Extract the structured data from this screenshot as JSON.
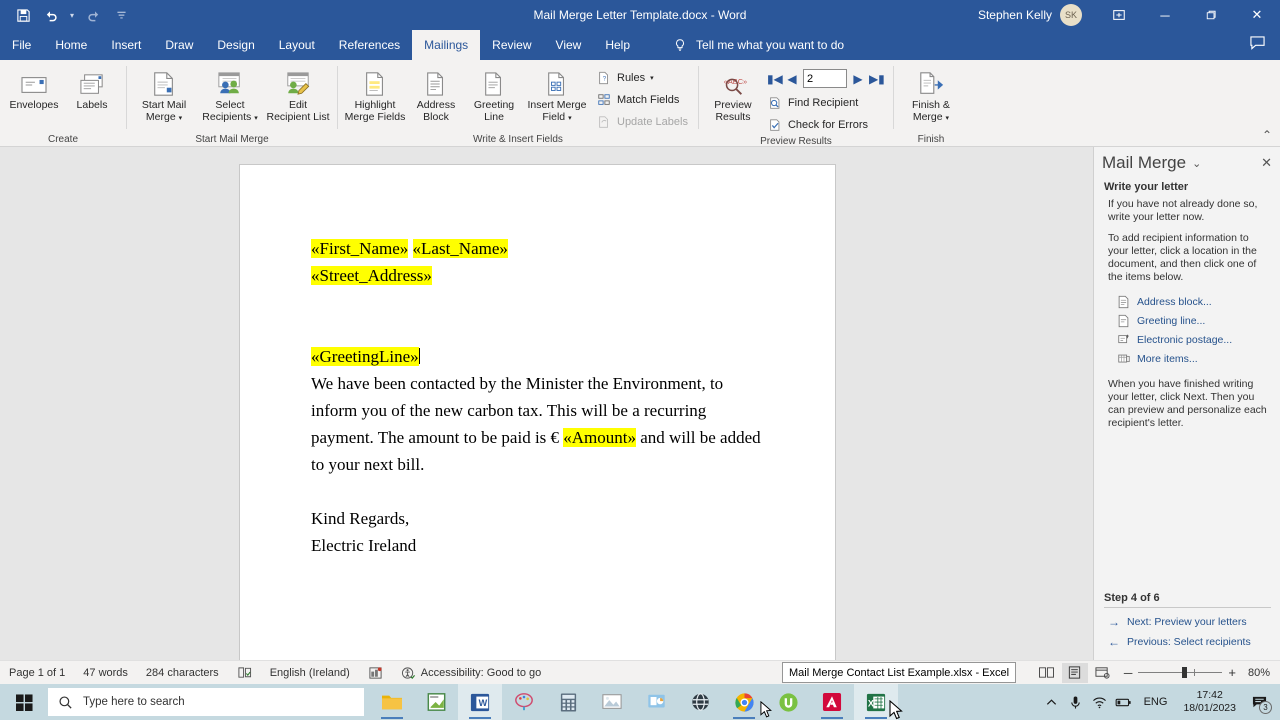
{
  "titlebar": {
    "document_title": "Mail Merge Letter Template.docx  -  Word",
    "user_name": "Stephen Kelly",
    "avatar_initials": "SK",
    "qat": [
      {
        "name": "save-icon",
        "label": "Save"
      },
      {
        "name": "undo-icon",
        "label": "Undo"
      },
      {
        "name": "redo-icon",
        "label": "Repeat"
      },
      {
        "name": "customize-qat-icon",
        "label": "Customize Quick Access Toolbar"
      }
    ],
    "window_buttons": {
      "ribbon_display": "Ribbon Display Options",
      "minimize": "─",
      "restore": "❐",
      "close": "✕"
    },
    "comments_icon": "comment-icon"
  },
  "tabs": [
    {
      "label": "File",
      "active": false
    },
    {
      "label": "Home",
      "active": false
    },
    {
      "label": "Insert",
      "active": false
    },
    {
      "label": "Draw",
      "active": false
    },
    {
      "label": "Design",
      "active": false
    },
    {
      "label": "Layout",
      "active": false
    },
    {
      "label": "References",
      "active": false
    },
    {
      "label": "Mailings",
      "active": true
    },
    {
      "label": "Review",
      "active": false
    },
    {
      "label": "View",
      "active": false
    },
    {
      "label": "Help",
      "active": false
    }
  ],
  "tellme": {
    "placeholder": "Tell me what you want to do"
  },
  "ribbon": {
    "groups": [
      {
        "name": "Create",
        "label": "Create",
        "buttons": [
          {
            "label1": "Envelopes",
            "label2": "",
            "icon": "envelope-icon",
            "dropdown": false
          },
          {
            "label1": "Labels",
            "label2": "",
            "icon": "labels-icon",
            "dropdown": false
          }
        ]
      },
      {
        "name": "Start Mail Merge",
        "label": "Start Mail Merge",
        "buttons": [
          {
            "label1": "Start Mail",
            "label2": "Merge",
            "icon": "start-mail-merge-icon",
            "dropdown": true
          },
          {
            "label1": "Select",
            "label2": "Recipients",
            "icon": "select-recipients-icon",
            "dropdown": true
          },
          {
            "label1": "Edit",
            "label2": "Recipient List",
            "icon": "edit-recipient-list-icon",
            "dropdown": false
          }
        ]
      },
      {
        "name": "Write & Insert Fields",
        "label": "Write & Insert Fields",
        "buttons": [
          {
            "label1": "Highlight",
            "label2": "Merge Fields",
            "icon": "highlight-merge-fields-icon",
            "dropdown": false
          },
          {
            "label1": "Address",
            "label2": "Block",
            "icon": "address-block-icon",
            "dropdown": false
          },
          {
            "label1": "Greeting",
            "label2": "Line",
            "icon": "greeting-line-icon",
            "dropdown": false
          },
          {
            "label1": "Insert Merge",
            "label2": "Field",
            "icon": "insert-merge-field-icon",
            "dropdown": true
          }
        ],
        "small_buttons": [
          {
            "label": "Rules",
            "icon": "rules-icon",
            "dropdown": true,
            "disabled": false
          },
          {
            "label": "Match Fields",
            "icon": "match-fields-icon",
            "dropdown": false,
            "disabled": false
          },
          {
            "label": "Update Labels",
            "icon": "update-labels-icon",
            "dropdown": false,
            "disabled": true
          }
        ]
      },
      {
        "name": "Preview Results",
        "label": "Preview Results",
        "buttons": [
          {
            "label1": "Preview",
            "label2": "Results",
            "icon": "preview-results-icon",
            "dropdown": false
          }
        ],
        "record_nav": {
          "first": "first-record-icon",
          "previous": "previous-record-icon",
          "value": "2",
          "next": "next-record-icon",
          "last": "last-record-icon"
        },
        "small_buttons": [
          {
            "label": "Find Recipient",
            "icon": "find-recipient-icon",
            "dropdown": false,
            "disabled": false
          },
          {
            "label": "Check for Errors",
            "icon": "check-for-errors-icon",
            "dropdown": false,
            "disabled": false
          }
        ]
      },
      {
        "name": "Finish",
        "label": "Finish",
        "buttons": [
          {
            "label1": "Finish &",
            "label2": "Merge",
            "icon": "finish-and-merge-icon",
            "dropdown": true
          }
        ]
      }
    ],
    "collapse_label": "⌃"
  },
  "document": {
    "lines": [
      {
        "type": "fields",
        "parts": [
          {
            "text": "«First_Name»",
            "highlight": true
          },
          {
            "text": " ",
            "highlight": false
          },
          {
            "text": "«Last_Name»",
            "highlight": true
          }
        ]
      },
      {
        "type": "fields",
        "parts": [
          {
            "text": "«Street_Address»",
            "highlight": true
          }
        ]
      },
      {
        "type": "blank",
        "parts": []
      },
      {
        "type": "blank",
        "parts": []
      },
      {
        "type": "fields",
        "parts": [
          {
            "text": "«GreetingLine»",
            "highlight": true
          }
        ],
        "caret": true
      },
      {
        "type": "body",
        "parts": [
          {
            "text": "We have been contacted by the Minister the Environment, to inform you of the new carbon tax. This will be a recurring payment. The amount to be paid is  € ",
            "highlight": false
          },
          {
            "text": "«Amount»",
            "highlight": true
          },
          {
            "text": " and will be added to your next bill.",
            "highlight": false
          }
        ]
      },
      {
        "type": "blank",
        "parts": []
      },
      {
        "type": "body",
        "parts": [
          {
            "text": "Kind Regards,",
            "highlight": false
          }
        ]
      },
      {
        "type": "body",
        "parts": [
          {
            "text": "Electric Ireland",
            "highlight": false
          }
        ]
      }
    ]
  },
  "taskpane": {
    "title": "Mail Merge",
    "chevron": "⌄",
    "close": "✕",
    "section_heading": "Write your letter",
    "paragraphs": [
      "If you have not already done so, write your letter now.",
      "To add recipient information to your letter, click a location in the document, and then click one of the items below."
    ],
    "links": [
      {
        "label": "Address block...",
        "icon": "address-block-icon"
      },
      {
        "label": "Greeting line...",
        "icon": "greeting-line-icon"
      },
      {
        "label": "Electronic postage...",
        "icon": "electronic-postage-icon"
      },
      {
        "label": "More items...",
        "icon": "more-items-icon"
      }
    ],
    "footer_paragraph": "When you have finished writing your letter, click Next. Then you can preview and personalize each recipient's letter.",
    "step_label": "Step 4 of 6",
    "next_label": "Next: Preview your letters",
    "previous_label": "Previous: Select recipients"
  },
  "statusbar": {
    "page": "Page 1 of 1",
    "words": "47 words",
    "characters": "284 characters",
    "proofing_icon": "proofing-icon",
    "language": "English (Ireland)",
    "macro_icon": "macro-record-icon",
    "accessibility_icon": "accessibility-icon",
    "accessibility": "Accessibility: Good to go",
    "views": [
      {
        "name": "read-mode-view",
        "icon": "read-mode-icon",
        "active": false
      },
      {
        "name": "print-layout-view",
        "icon": "print-layout-icon",
        "active": true
      },
      {
        "name": "web-layout-view",
        "icon": "web-layout-icon",
        "active": false
      }
    ],
    "zoom_out": "─",
    "zoom_in": "+",
    "zoom_level": "80%",
    "tooltip": "Mail Merge Contact List Example.xlsx  -  Excel"
  },
  "taskbar": {
    "start_icon": "windows-start-icon",
    "search_placeholder": "Type here to search",
    "search_icon": "search-icon",
    "apps": [
      {
        "name": "file-explorer-icon",
        "running": true,
        "hover": false
      },
      {
        "name": "notepad-icon",
        "running": false,
        "hover": false
      },
      {
        "name": "word-icon",
        "running": true,
        "hover": true
      },
      {
        "name": "paint-icon",
        "running": false,
        "hover": false
      },
      {
        "name": "calculator-icon",
        "running": false,
        "hover": false
      },
      {
        "name": "photos-icon",
        "running": false,
        "hover": false
      },
      {
        "name": "powerpoint-icon",
        "running": false,
        "hover": false
      },
      {
        "name": "browser-icon",
        "running": false,
        "hover": false
      },
      {
        "name": "chrome-icon",
        "running": true,
        "hover": false
      },
      {
        "name": "utorrent-icon",
        "running": false,
        "hover": false
      },
      {
        "name": "adobe-icon",
        "running": true,
        "hover": false
      },
      {
        "name": "excel-icon",
        "running": true,
        "hover": true
      }
    ],
    "tray": {
      "show_hidden_icon": "chevron-up-icon",
      "microphone_icon": "microphone-icon",
      "network_icon": "wifi-icon",
      "battery_icon": "battery-icon",
      "language": "ENG",
      "time": "17:42",
      "date": "18/01/2023",
      "notification_icon": "notification-icon",
      "notification_count": "3"
    }
  },
  "colors": {
    "word_blue": "#2b579a",
    "ribbon_bg": "#f3f2f1",
    "highlight_yellow": "#ffff00",
    "workspace_gray": "#e6e6e6",
    "taskbar": "#c5d9e0",
    "link_blue": "#26528c"
  }
}
